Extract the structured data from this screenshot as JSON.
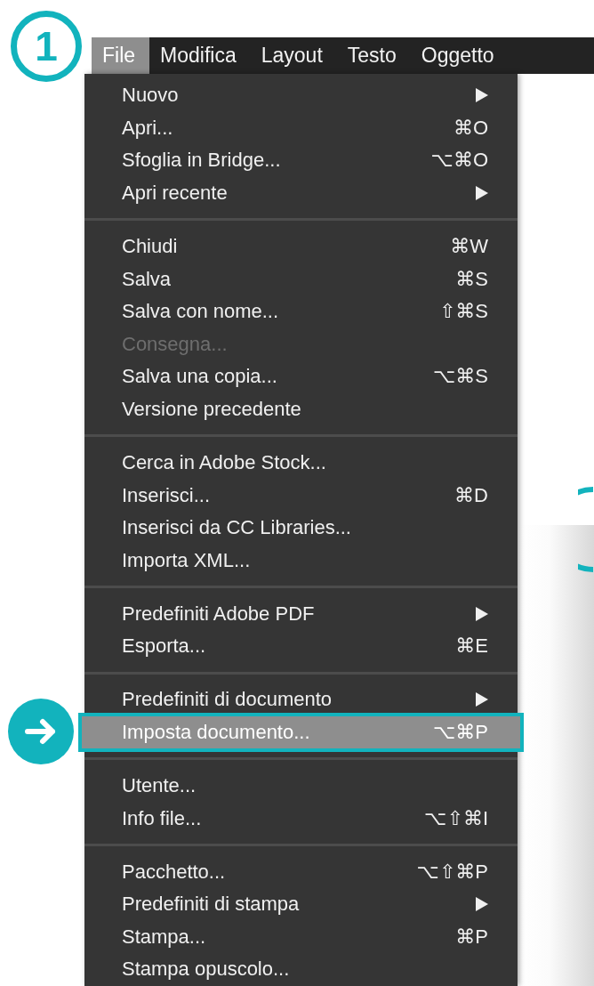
{
  "step_badge": "1",
  "menubar": [
    {
      "label": "File",
      "selected": true
    },
    {
      "label": "Modifica",
      "selected": false
    },
    {
      "label": "Layout",
      "selected": false
    },
    {
      "label": "Testo",
      "selected": false
    },
    {
      "label": "Oggetto",
      "selected": false
    }
  ],
  "menu": {
    "groups": [
      [
        {
          "label": "Nuovo",
          "kind": "submenu",
          "disabled": false,
          "selected": false
        },
        {
          "label": "Apri...",
          "shortcut": "⌘O",
          "kind": "command",
          "disabled": false,
          "selected": false
        },
        {
          "label": "Sfoglia in Bridge...",
          "shortcut": "⌥⌘O",
          "kind": "command",
          "disabled": false,
          "selected": false
        },
        {
          "label": "Apri recente",
          "kind": "submenu",
          "disabled": false,
          "selected": false
        }
      ],
      [
        {
          "label": "Chiudi",
          "shortcut": "⌘W",
          "kind": "command",
          "disabled": false,
          "selected": false
        },
        {
          "label": "Salva",
          "shortcut": "⌘S",
          "kind": "command",
          "disabled": false,
          "selected": false
        },
        {
          "label": "Salva con nome...",
          "shortcut": "⇧⌘S",
          "kind": "command",
          "disabled": false,
          "selected": false
        },
        {
          "label": "Consegna...",
          "kind": "command",
          "disabled": true,
          "selected": false
        },
        {
          "label": "Salva una copia...",
          "shortcut": "⌥⌘S",
          "kind": "command",
          "disabled": false,
          "selected": false
        },
        {
          "label": "Versione precedente",
          "kind": "command",
          "disabled": false,
          "selected": false
        }
      ],
      [
        {
          "label": "Cerca in Adobe Stock...",
          "kind": "command",
          "disabled": false,
          "selected": false
        },
        {
          "label": "Inserisci...",
          "shortcut": "⌘D",
          "kind": "command",
          "disabled": false,
          "selected": false
        },
        {
          "label": "Inserisci da CC Libraries...",
          "kind": "command",
          "disabled": false,
          "selected": false
        },
        {
          "label": "Importa XML...",
          "kind": "command",
          "disabled": false,
          "selected": false
        }
      ],
      [
        {
          "label": "Predefiniti Adobe PDF",
          "kind": "submenu",
          "disabled": false,
          "selected": false
        },
        {
          "label": "Esporta...",
          "shortcut": "⌘E",
          "kind": "command",
          "disabled": false,
          "selected": false
        }
      ],
      [
        {
          "label": "Predefiniti di documento",
          "kind": "submenu",
          "disabled": false,
          "selected": false
        },
        {
          "label": "Imposta documento...",
          "shortcut": "⌥⌘P",
          "kind": "command",
          "disabled": false,
          "selected": true
        }
      ],
      [
        {
          "label": "Utente...",
          "kind": "command",
          "disabled": false,
          "selected": false
        },
        {
          "label": "Info file...",
          "shortcut": "⌥⇧⌘I",
          "kind": "command",
          "disabled": false,
          "selected": false
        }
      ],
      [
        {
          "label": "Pacchetto...",
          "shortcut": "⌥⇧⌘P",
          "kind": "command",
          "disabled": false,
          "selected": false
        },
        {
          "label": "Predefiniti di stampa",
          "kind": "submenu",
          "disabled": false,
          "selected": false
        },
        {
          "label": "Stampa...",
          "shortcut": "⌘P",
          "kind": "command",
          "disabled": false,
          "selected": false
        },
        {
          "label": "Stampa opuscolo...",
          "kind": "command",
          "disabled": false,
          "selected": false
        }
      ]
    ]
  }
}
